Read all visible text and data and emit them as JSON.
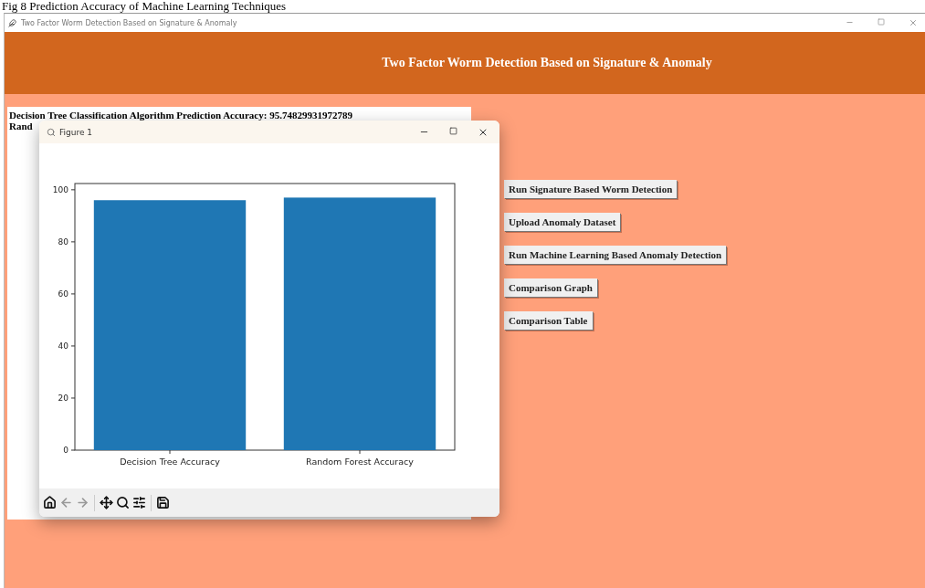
{
  "caption": "Fig 8 Prediction Accuracy of Machine Learning Techniques",
  "window": {
    "title": "Two Factor Worm Detection Based on Signature & Anomaly"
  },
  "header": "Two Factor Worm Detection Based on Signature & Anomaly",
  "output_lines": [
    "Decision Tree Classification Algorithm Prediction Accuracy: 95.74829931972789",
    "Rand"
  ],
  "buttons": [
    "Run Signature Based Worm Detection",
    "Upload Anomaly Dataset",
    "Run Machine Learning Based Anomaly Detection",
    "Comparison Graph",
    "Comparison Table"
  ],
  "figure": {
    "title": "Figure 1",
    "chart_data": {
      "type": "bar",
      "categories": [
        "Decision Tree Accuracy",
        "Random Forest Accuracy"
      ],
      "values": [
        96,
        97
      ],
      "ylim": [
        0,
        102.4
      ],
      "yticks": [
        0,
        20,
        40,
        60,
        80,
        100
      ]
    },
    "toolbar": [
      {
        "kind": "home",
        "disabled": false
      },
      {
        "kind": "back",
        "disabled": true
      },
      {
        "kind": "forward",
        "disabled": true
      },
      {
        "kind": "pan",
        "disabled": false
      },
      {
        "kind": "zoom",
        "disabled": false
      },
      {
        "kind": "configure",
        "disabled": false
      },
      {
        "kind": "save",
        "disabled": false
      }
    ]
  }
}
